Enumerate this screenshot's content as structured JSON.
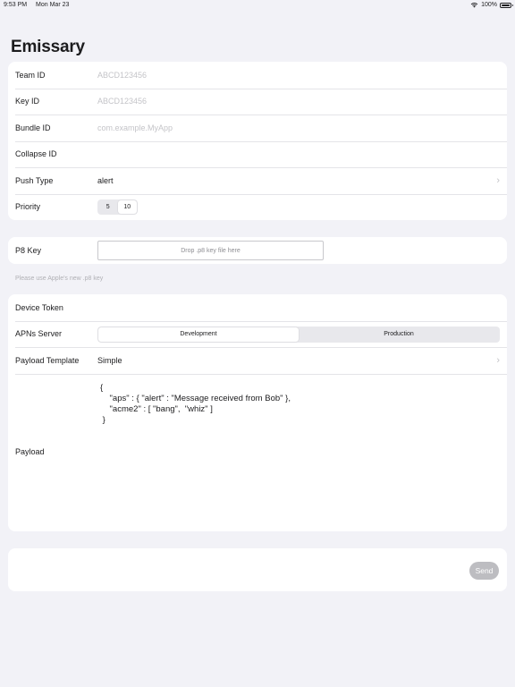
{
  "status_bar": {
    "time": "9:53 PM",
    "date": "Mon Mar 23",
    "battery": "100%"
  },
  "app": {
    "title": "Emissary"
  },
  "credentials": {
    "team_id": {
      "label": "Team ID",
      "placeholder": "ABCD123456"
    },
    "key_id": {
      "label": "Key ID",
      "placeholder": "ABCD123456"
    },
    "bundle_id": {
      "label": "Bundle ID",
      "placeholder": "com.example.MyApp"
    },
    "collapse_id": {
      "label": "Collapse ID",
      "value": ""
    },
    "push_type": {
      "label": "Push Type",
      "value": "alert"
    },
    "priority": {
      "label": "Priority",
      "options": [
        "5",
        "10"
      ],
      "selected": "10"
    }
  },
  "p8": {
    "label": "P8 Key",
    "drop_text": "Drop .p8 key file here",
    "footnote": "Please use Apple's new .p8 key"
  },
  "device": {
    "token_label": "Device Token",
    "server_label": "APNs Server",
    "server_options": [
      "Development",
      "Production"
    ],
    "server_selected": "Development",
    "template_label": "Payload Template",
    "template_value": "Simple",
    "payload_label": "Payload",
    "payload_text": "{\n    \"aps\" : { \"alert\" : \"Message received from Bob\" },\n    \"acme2\" : [ \"bang\",  \"whiz\" ]\n }"
  },
  "send": {
    "label": "Send"
  }
}
